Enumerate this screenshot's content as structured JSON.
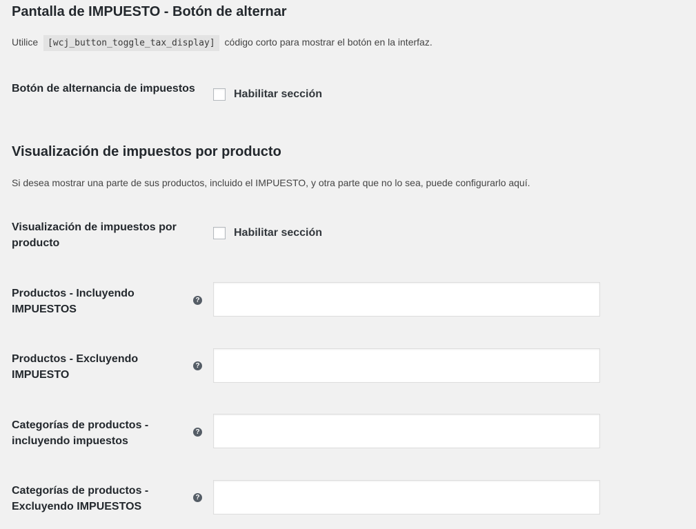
{
  "section1": {
    "title": "Pantalla de IMPUESTO - Botón de alternar",
    "desc_before": "Utilice",
    "shortcode": "[wcj_button_toggle_tax_display]",
    "desc_after": "código corto para mostrar el botón en la interfaz.",
    "row": {
      "label": "Botón de alternancia de impuestos",
      "checkbox_label": "Habilitar sección",
      "checked": false
    }
  },
  "section2": {
    "title": "Visualización de impuestos por producto",
    "desc": "Si desea mostrar una parte de sus productos, incluido el IMPUESTO, y otra parte que no lo sea, puede configurarlo aquí.",
    "enable_row": {
      "label": "Visualización de impuestos por producto",
      "checkbox_label": "Habilitar sección",
      "checked": false
    },
    "fields": [
      {
        "label": "Productos - Incluyendo IMPUESTOS",
        "value": "",
        "help_icon": "question-circle-icon"
      },
      {
        "label": "Productos - Excluyendo IMPUESTO",
        "value": "",
        "help_icon": "question-circle-icon"
      },
      {
        "label": "Categorías de productos - incluyendo impuestos",
        "value": "",
        "help_icon": "question-circle-icon"
      },
      {
        "label": "Categorías de productos - Excluyendo IMPUESTOS",
        "value": "",
        "help_icon": "question-circle-icon"
      }
    ]
  },
  "colors": {
    "background": "#f1f1f1",
    "text": "#23282d",
    "input_border": "#ddd",
    "help_icon": "#555d66"
  }
}
